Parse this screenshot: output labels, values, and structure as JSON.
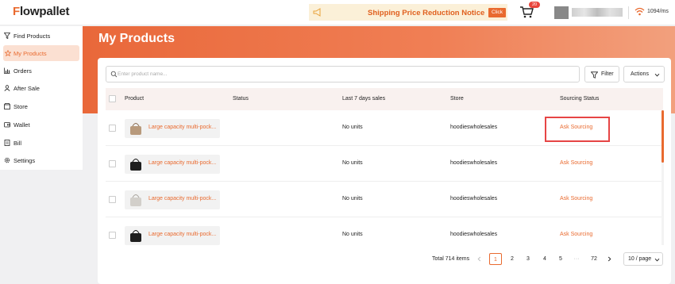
{
  "topbar": {
    "logo_first": "F",
    "logo_rest": "lowpallet",
    "notice_text": "Shipping Price Reduction Notice",
    "notice_click": "Click",
    "cart_count": "20",
    "ping": "1094/ms"
  },
  "sidebar": {
    "items": [
      {
        "label": "Find Products",
        "icon": "filter-icon"
      },
      {
        "label": "My Products",
        "icon": "star-icon"
      },
      {
        "label": "Orders",
        "icon": "chart-icon"
      },
      {
        "label": "After Sale",
        "icon": "user-icon"
      },
      {
        "label": "Store",
        "icon": "store-icon"
      },
      {
        "label": "Wallet",
        "icon": "wallet-icon"
      },
      {
        "label": "Bill",
        "icon": "bill-icon"
      },
      {
        "label": "Settings",
        "icon": "gear-icon"
      }
    ]
  },
  "main": {
    "title": "My Products",
    "search_placeholder": "Enter product name...",
    "filter_label": "Filter",
    "actions_label": "Actions",
    "columns": [
      "Product",
      "Status",
      "Last 7 days sales",
      "Store",
      "Sourcing Status"
    ],
    "rows": [
      {
        "name": "Large capacity multi-pock...",
        "status": "",
        "sales": "No units",
        "store": "hoodieswholesales",
        "sourcing": "Ask Sourcing",
        "thumb_color": "#b89a7c"
      },
      {
        "name": "Large capacity multi-pock...",
        "status": "",
        "sales": "No units",
        "store": "hoodieswholesales",
        "sourcing": "Ask Sourcing",
        "thumb_color": "#1e1e1e"
      },
      {
        "name": "Large capacity multi-pock...",
        "status": "",
        "sales": "No units",
        "store": "hoodieswholesales",
        "sourcing": "Ask Sourcing",
        "thumb_color": "#d2cfca"
      },
      {
        "name": "Large capacity multi-pock...",
        "status": "",
        "sales": "No units",
        "store": "hoodieswholesales",
        "sourcing": "Ask Sourcing",
        "thumb_color": "#1e1e1e"
      }
    ]
  },
  "pagination": {
    "total": "Total 714 items",
    "pages": [
      "1",
      "2",
      "3",
      "4",
      "5",
      "···",
      "72"
    ],
    "current": "1",
    "per_page": "10 / page"
  },
  "colors": {
    "accent": "#e96a2f",
    "highlight": "#e64545"
  }
}
